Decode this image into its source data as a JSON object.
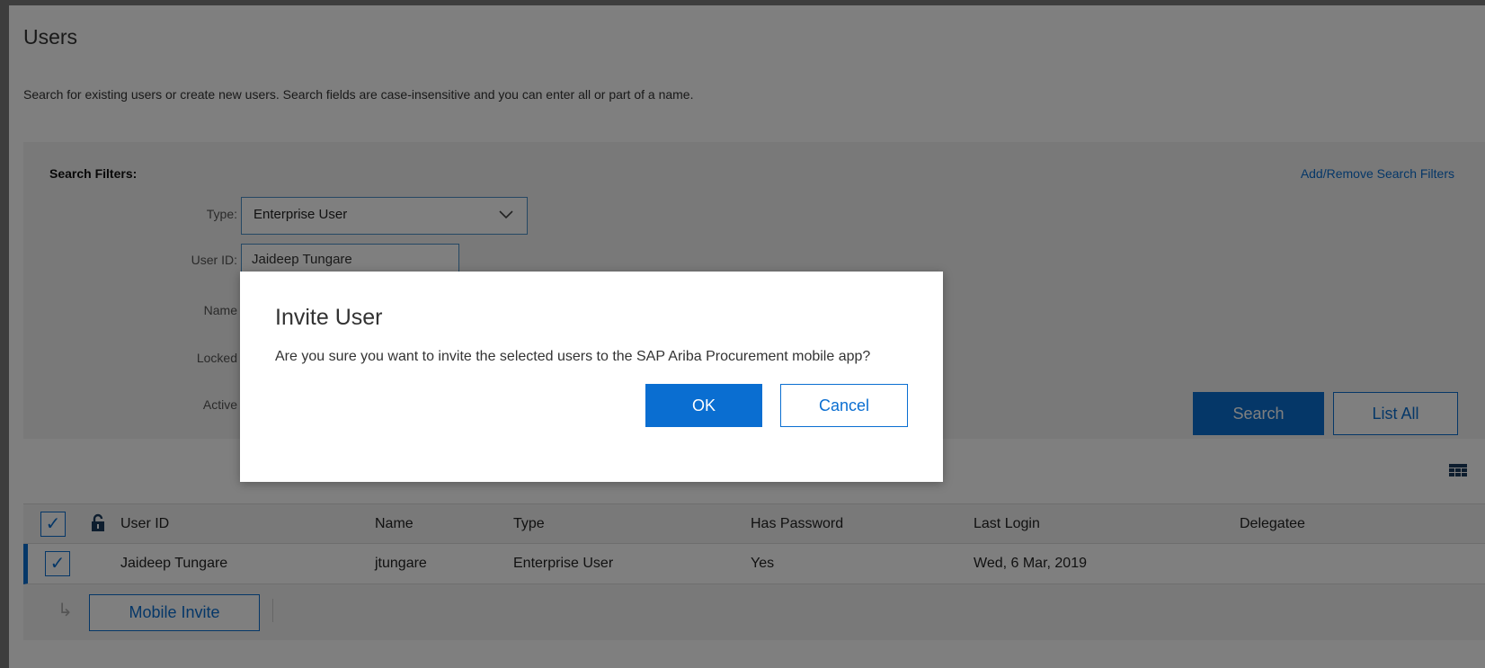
{
  "page": {
    "title": "Users",
    "description": "Search for existing users or create new users.  Search fields are case-insensitive and you can enter all or part of a name."
  },
  "filters": {
    "heading": "Search Filters:",
    "add_remove_link": "Add/Remove Search Filters",
    "type_label": "Type:",
    "type_value": "Enterprise User",
    "userid_label": "User ID:",
    "userid_value": "Jaideep Tungare",
    "name_label": "Name",
    "locked_label": "Locked",
    "active_label": "Active",
    "search_button": "Search",
    "list_all_button": "List All"
  },
  "table": {
    "columns": [
      "User ID",
      "Name",
      "Type",
      "Has Password",
      "Last Login",
      "Delegatee"
    ],
    "rows": [
      {
        "user_id": "Jaideep Tungare",
        "name": "jtungare",
        "type": "Enterprise User",
        "has_password": "Yes",
        "last_login": "Wed, 6 Mar, 2019",
        "delegatee": ""
      }
    ],
    "action_button": "Mobile Invite"
  },
  "dialog": {
    "title": "Invite User",
    "message": "Are you sure you want to invite the selected users to the SAP Ariba Procurement mobile app?",
    "ok_label": "OK",
    "cancel_label": "Cancel"
  },
  "colors": {
    "accent": "#0a6ed1",
    "overlay": "rgba(0,0,0,0.5)"
  }
}
